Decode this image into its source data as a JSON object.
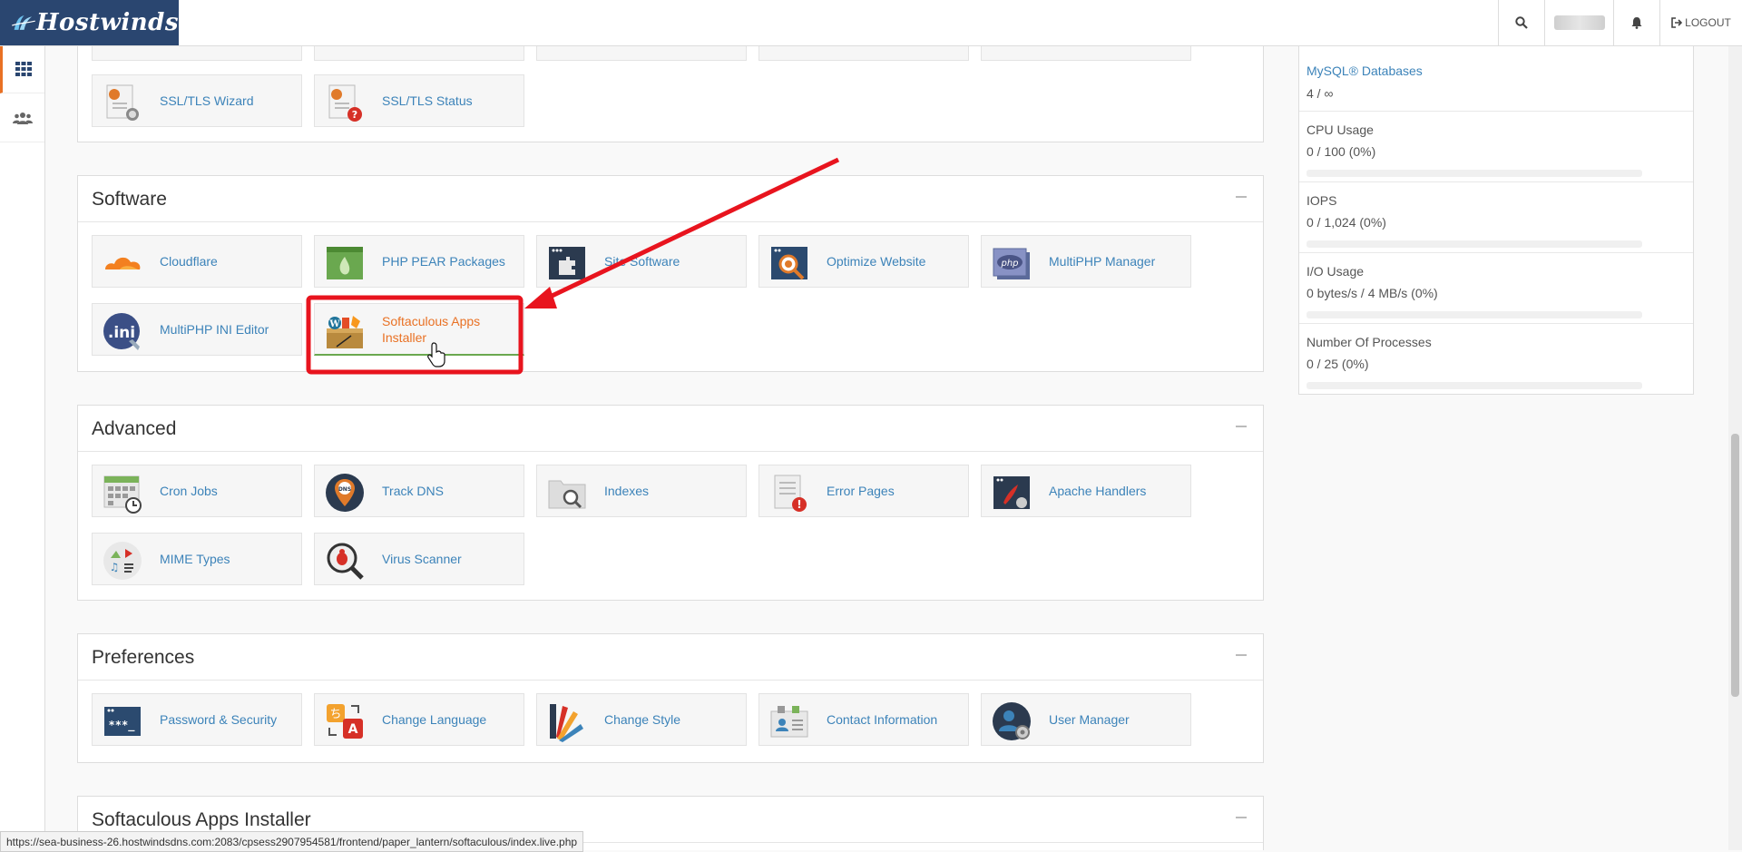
{
  "app": {
    "brand": "Hostwinds",
    "logout_label": "LOGOUT",
    "status_url": "https://sea-business-26.hostwindsdns.com:2083/cpsess2907954581/frontend/paper_lantern/softaculous/index.live.php"
  },
  "colors": {
    "accent": "#e97124",
    "link": "#3c83b9",
    "brand_bg": "#2a4670",
    "annotation": "#e8141e"
  },
  "security": {
    "items": [
      {
        "label": "SSL/TLS Wizard",
        "icon": "ssl-wizard-icon"
      },
      {
        "label": "SSL/TLS Status",
        "icon": "ssl-status-icon"
      }
    ]
  },
  "software": {
    "title": "Software",
    "items": [
      {
        "label": "Cloudflare",
        "icon": "cloudflare-icon"
      },
      {
        "label": "PHP PEAR Packages",
        "icon": "php-pear-icon"
      },
      {
        "label": "Site Software",
        "icon": "site-software-icon"
      },
      {
        "label": "Optimize Website",
        "icon": "optimize-website-icon"
      },
      {
        "label": "MultiPHP Manager",
        "icon": "multiphp-manager-icon"
      },
      {
        "label": "MultiPHP INI Editor",
        "icon": "multiphp-ini-icon"
      },
      {
        "label": "Softaculous Apps Installer",
        "icon": "softaculous-icon"
      }
    ]
  },
  "advanced": {
    "title": "Advanced",
    "items": [
      {
        "label": "Cron Jobs",
        "icon": "cron-jobs-icon"
      },
      {
        "label": "Track DNS",
        "icon": "track-dns-icon"
      },
      {
        "label": "Indexes",
        "icon": "indexes-icon"
      },
      {
        "label": "Error Pages",
        "icon": "error-pages-icon"
      },
      {
        "label": "Apache Handlers",
        "icon": "apache-handlers-icon"
      },
      {
        "label": "MIME Types",
        "icon": "mime-types-icon"
      },
      {
        "label": "Virus Scanner",
        "icon": "virus-scanner-icon"
      }
    ]
  },
  "preferences": {
    "title": "Preferences",
    "items": [
      {
        "label": "Password & Security",
        "icon": "password-security-icon"
      },
      {
        "label": "Change Language",
        "icon": "change-language-icon"
      },
      {
        "label": "Change Style",
        "icon": "change-style-icon"
      },
      {
        "label": "Contact Information",
        "icon": "contact-information-icon"
      },
      {
        "label": "User Manager",
        "icon": "user-manager-icon"
      }
    ]
  },
  "softaculous_section": {
    "title": "Softaculous Apps Installer"
  },
  "stats": [
    {
      "title": "MySQL® Databases",
      "value": "4 / ∞"
    },
    {
      "title": "CPU Usage",
      "value": "0 / 100   (0%)",
      "percent": 0
    },
    {
      "title": "IOPS",
      "value": "0 / 1,024   (0%)",
      "percent": 0
    },
    {
      "title": "I/O Usage",
      "value": "0 bytes/s / 4 MB/s   (0%)",
      "percent": 0
    },
    {
      "title": "Number Of Processes",
      "value": "0 / 25   (0%)",
      "percent": 0
    }
  ]
}
